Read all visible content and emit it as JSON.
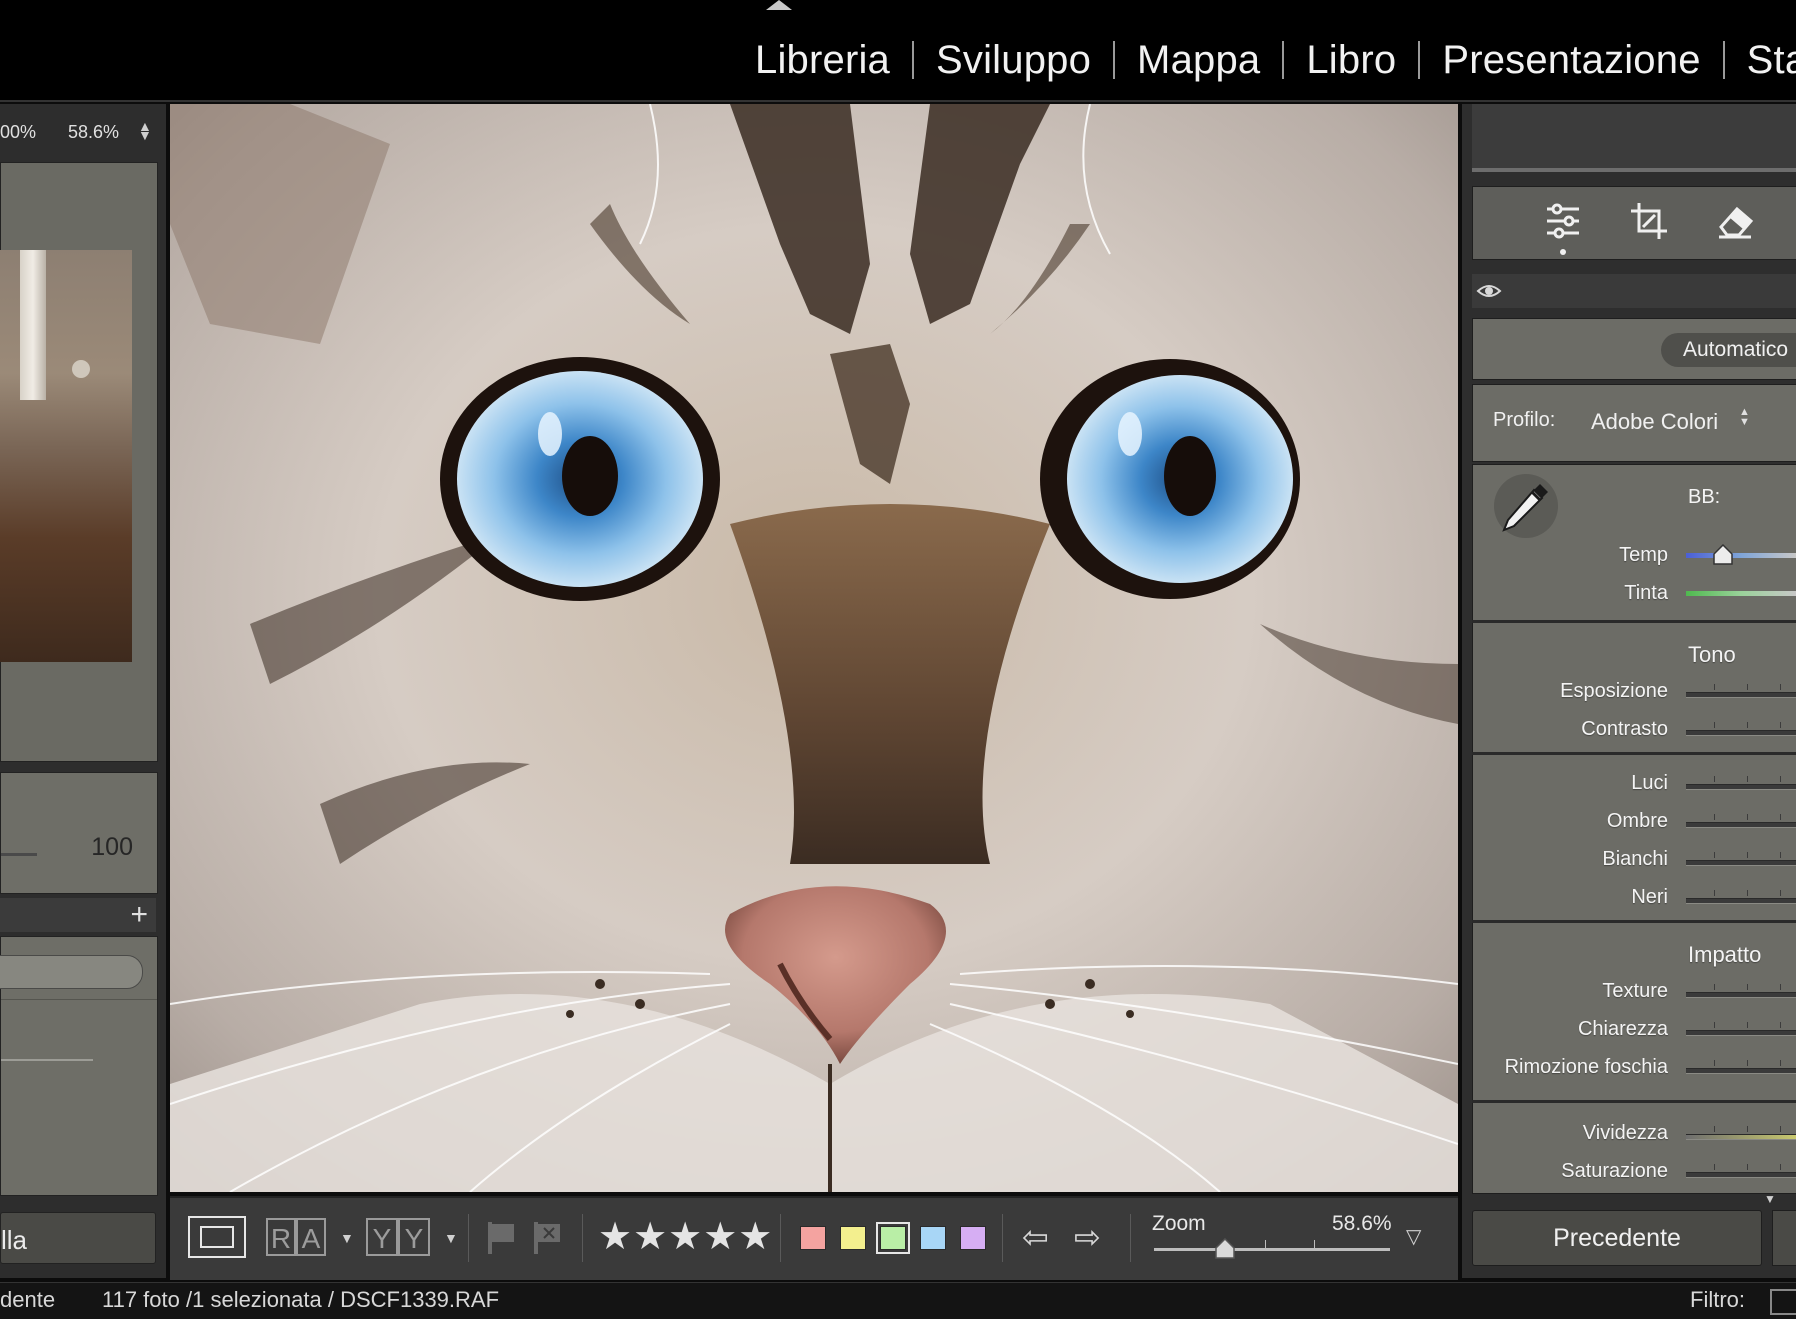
{
  "modules": [
    "Libreria",
    "Sviluppo",
    "Mappa",
    "Libro",
    "Presentazione",
    "Sta"
  ],
  "navigator": {
    "zoom_fit": "00%",
    "zoom_current": "58.6%",
    "value": "100"
  },
  "left_panel": {
    "button_label": "lla"
  },
  "toolbar": {
    "view_compare_labels": [
      "R",
      "A"
    ],
    "view_survey_labels": [
      "Y",
      "Y"
    ],
    "stars": "★★★★★",
    "color_labels": [
      "#f4a3a0",
      "#f3ef8e",
      "#b9eea6",
      "#a8d6f6",
      "#d6aef3"
    ],
    "zoom_label": "Zoom",
    "zoom_value": "58.6%",
    "zoom_level": 0.3
  },
  "right_panel": {
    "tool_icons": [
      "sliders-icon",
      "crop-icon",
      "eraser-icon"
    ],
    "auto_button": "Automatico",
    "profile_label": "Profilo:",
    "profile_value": "Adobe Colori",
    "wb_label": "BB:",
    "wb_sliders": [
      {
        "label": "Temp"
      },
      {
        "label": "Tinta"
      }
    ],
    "tone_title": "Tono",
    "tone_sliders": [
      {
        "label": "Esposizione"
      },
      {
        "label": "Contrasto"
      }
    ],
    "light_sliders": [
      {
        "label": "Luci"
      },
      {
        "label": "Ombre"
      },
      {
        "label": "Bianchi"
      },
      {
        "label": "Neri"
      }
    ],
    "presence_title": "Impatto",
    "presence_sliders": [
      {
        "label": "Texture"
      },
      {
        "label": "Chiarezza"
      },
      {
        "label": "Rimozione foschia"
      }
    ],
    "color_sliders": [
      {
        "label": "Vividezza"
      },
      {
        "label": "Saturazione"
      }
    ],
    "previous_button": "Precedente"
  },
  "statusbar": {
    "left_text": "dente",
    "info_text": "117 foto /1 selezionata / DSCF1339.RAF",
    "filter_label": "Filtro:"
  }
}
